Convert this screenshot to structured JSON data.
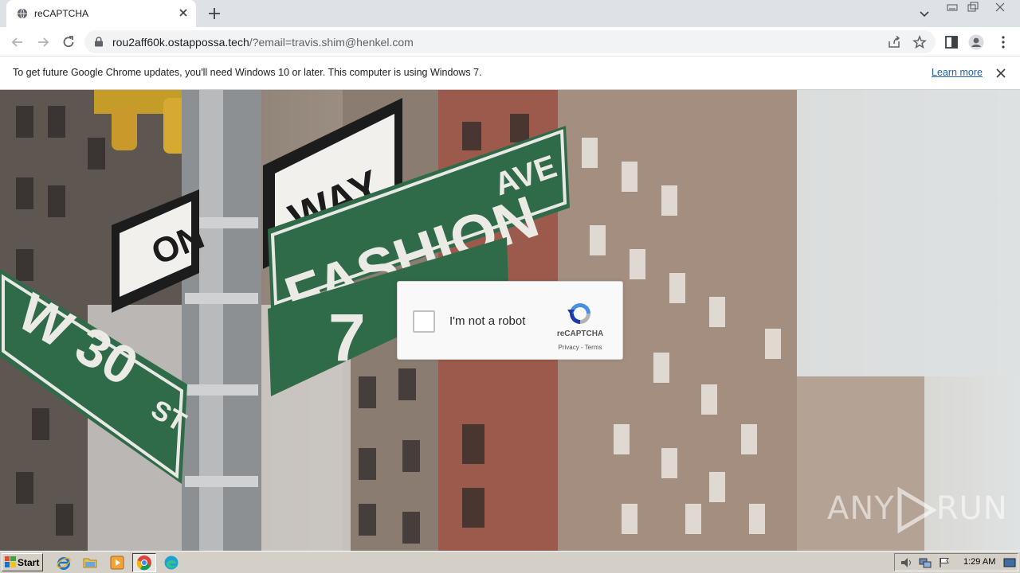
{
  "browser": {
    "tab": {
      "title": "reCAPTCHA"
    },
    "url": {
      "host": "rou2aff60k.ostappossa.tech",
      "path": "/?email=travis.shim@henkel.com"
    }
  },
  "infobar": {
    "message": "To get future Google Chrome updates, you'll need Windows 10 or later. This computer is using Windows 7.",
    "link": "Learn more"
  },
  "scene": {
    "signs": {
      "one_way": "WAY",
      "one_way_partial": "ON",
      "fashion": "FASHION",
      "ave": "AVE",
      "seventh": "7",
      "w30": "W 30",
      "st": "ST"
    }
  },
  "captcha": {
    "label": "I'm not a robot",
    "brand": "reCAPTCHA",
    "privacy": "Privacy",
    "separator": " - ",
    "terms": "Terms",
    "checked": false
  },
  "watermark": {
    "left": "ANY",
    "right": "RUN"
  },
  "taskbar": {
    "start_label": "Start",
    "clock": "1:29 AM",
    "pinned": [
      "internet-explorer-icon",
      "explorer-folder-icon",
      "media-player-icon",
      "chrome-icon",
      "edge-icon"
    ]
  },
  "colors": {
    "sign_green": "#2f6b48",
    "accent_link": "#1a5fb4",
    "captcha_blue": "#4a90e2",
    "taskbar": "#d4d0c8"
  }
}
